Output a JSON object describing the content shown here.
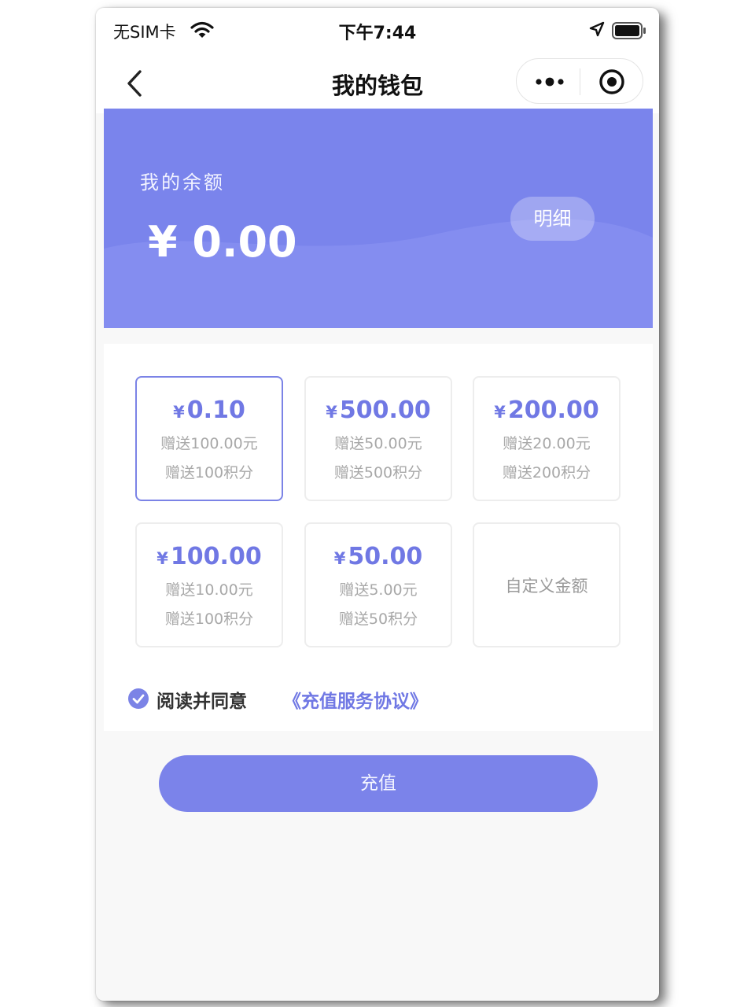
{
  "status_bar": {
    "carrier": "无SIM卡",
    "time": "下午7:44"
  },
  "nav": {
    "title": "我的钱包"
  },
  "wallet": {
    "balance_label": "我的余额",
    "balance": "¥ 0.00",
    "detail_button": "明细"
  },
  "currency_symbol": "¥",
  "recharge_options": [
    {
      "amount": "0.10",
      "bonus_cash": "赠送100.00元",
      "bonus_points": "赠送100积分",
      "selected": true
    },
    {
      "amount": "500.00",
      "bonus_cash": "赠送50.00元",
      "bonus_points": "赠送500积分",
      "selected": false
    },
    {
      "amount": "200.00",
      "bonus_cash": "赠送20.00元",
      "bonus_points": "赠送200积分",
      "selected": false
    },
    {
      "amount": "100.00",
      "bonus_cash": "赠送10.00元",
      "bonus_points": "赠送100积分",
      "selected": false
    },
    {
      "amount": "50.00",
      "bonus_cash": "赠送5.00元",
      "bonus_points": "赠送50积分",
      "selected": false
    }
  ],
  "custom_amount_label": "自定义金额",
  "agreement": {
    "checked": true,
    "text": "阅读并同意",
    "link": "《充值服务协议》"
  },
  "recharge_button": "充值",
  "colors": {
    "accent": "#7b83ea",
    "banner": "#7a84ec",
    "selected_border": "#7b83e6",
    "muted_text": "#a8a8a8"
  },
  "icons": [
    "wifi-icon",
    "location-icon",
    "battery-icon",
    "back-icon",
    "more-icon",
    "target-icon",
    "check-icon"
  ]
}
